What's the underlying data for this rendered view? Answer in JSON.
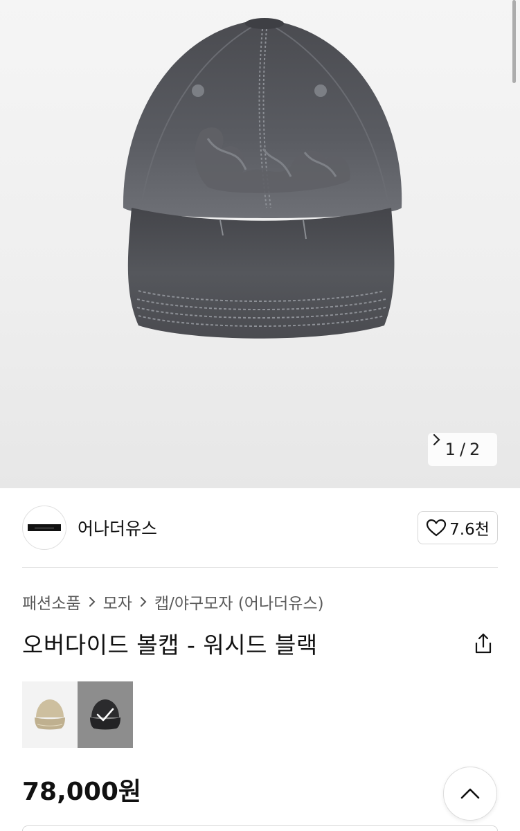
{
  "gallery": {
    "current": "1",
    "separator": "/",
    "total": "2",
    "image_icon": "baseball-cap-photo"
  },
  "brand": {
    "name": "어나더유스",
    "logo_icon": "brand-logo",
    "like_count": "7.6천",
    "like_icon": "heart-outline-icon"
  },
  "breadcrumb": {
    "items": [
      "패션소품",
      "모자",
      "캡/야구모자 (어나더유스)"
    ],
    "separator_icon": "chevron-right-icon"
  },
  "product": {
    "title": "오버다이드 볼캡 - 워시드 블랙",
    "share_icon": "share-icon",
    "price": "78,000원"
  },
  "options": {
    "swatches": [
      {
        "name": "beige-cap",
        "selected": false,
        "color": "#cdbf9f"
      },
      {
        "name": "black-cap",
        "selected": true,
        "color": "#2b2b2d"
      }
    ],
    "check_icon": "check-icon"
  },
  "scroll_top": {
    "icon": "chevron-up-icon"
  }
}
